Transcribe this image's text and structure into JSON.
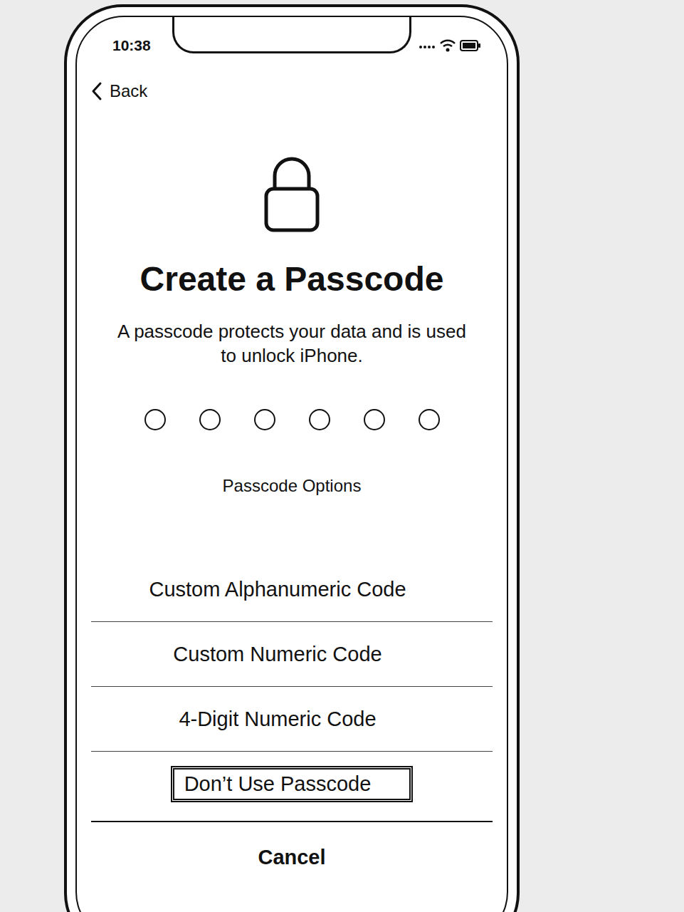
{
  "status_bar": {
    "time": "10:38"
  },
  "nav": {
    "back": "Back"
  },
  "title": "Create a Passcode",
  "subtitle": "A passcode protects your data and is used to unlock iPhone.",
  "passcode_dots": [
    {
      "filled": false
    },
    {
      "filled": false
    },
    {
      "filled": false
    },
    {
      "filled": false
    },
    {
      "filled": false
    },
    {
      "filled": false
    }
  ],
  "options_link": "Passcode Options",
  "action_sheet": {
    "options": [
      {
        "label": "Custom Alphanumeric Code",
        "selected": false
      },
      {
        "label": "Custom Numeric Code",
        "selected": false
      },
      {
        "label": "4-Digit Numeric Code",
        "selected": false
      },
      {
        "label": "Don’t Use Passcode",
        "selected": true
      }
    ],
    "cancel": "Cancel"
  }
}
